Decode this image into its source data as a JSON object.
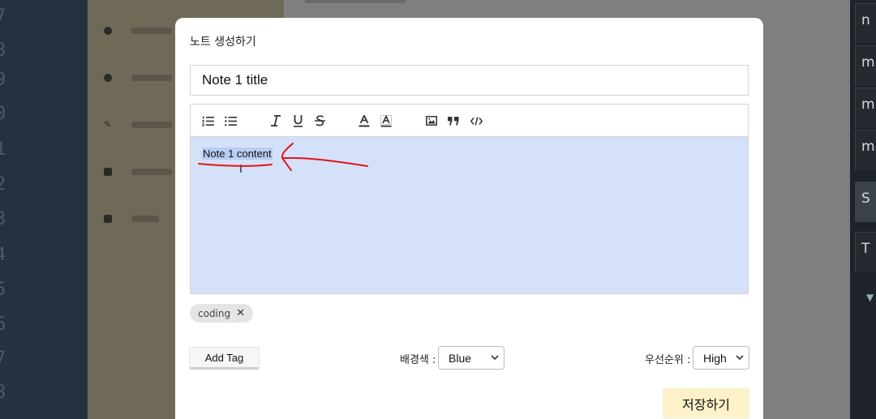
{
  "background": {
    "gutter_numbers": [
      "7",
      "8",
      "9",
      "0",
      "1",
      "2",
      "3",
      "4",
      "5",
      "6",
      "7",
      "8"
    ],
    "right_panel": [
      "n",
      "m",
      "m",
      "m",
      "S",
      "T"
    ]
  },
  "modal": {
    "title": "노트 생성하기",
    "title_input_value": "Note 1 title",
    "editor": {
      "toolbar_icons": [
        "ordered-list-icon",
        "bullet-list-icon",
        "italic-icon",
        "underline-icon",
        "strikethrough-icon",
        "text-color-icon",
        "background-color-icon",
        "image-icon",
        "quote-icon",
        "code-icon"
      ],
      "content": "Note 1 content",
      "selection_color": "#b8cdf2",
      "area_color": "#d5e1f8"
    },
    "tags": [
      {
        "label": "coding"
      }
    ],
    "add_tag_label": "Add Tag",
    "bg_color_label": "배경색 :",
    "bg_color_value": "Blue",
    "priority_label": "우선순위 :",
    "priority_value": "High",
    "save_label": "저장하기",
    "save_color": "#fdf1c9",
    "annotation_color": "#e0141c"
  }
}
